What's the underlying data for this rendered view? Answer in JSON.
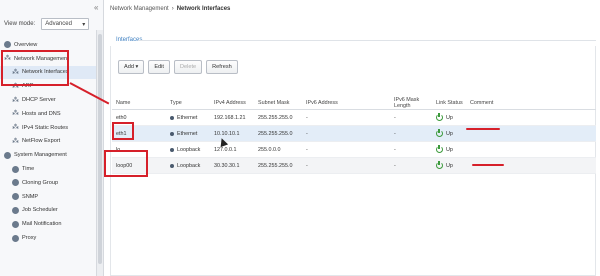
{
  "sidebar": {
    "view_mode_label": "View mode:",
    "view_mode_value": "Advanced",
    "collapse_glyph": "«",
    "items": [
      {
        "label": "Overview",
        "icon": "overview-icon"
      },
      {
        "label": "Network Management",
        "icon": "network-icon"
      },
      {
        "label": "Network Interfaces",
        "icon": "network-interfaces-icon"
      },
      {
        "label": "ARP",
        "icon": "arp-icon"
      },
      {
        "label": "DHCP Server",
        "icon": "dhcp-icon"
      },
      {
        "label": "Hosts and DNS",
        "icon": "hosts-dns-icon"
      },
      {
        "label": "IPv4 Static Routes",
        "icon": "routes-icon"
      },
      {
        "label": "NetFlow Export",
        "icon": "netflow-icon"
      },
      {
        "label": "System Management",
        "icon": "system-icon"
      },
      {
        "label": "Time",
        "icon": "time-icon"
      },
      {
        "label": "Cloning Group",
        "icon": "cloning-icon"
      },
      {
        "label": "SNMP",
        "icon": "snmp-icon"
      },
      {
        "label": "Job Scheduler",
        "icon": "scheduler-icon"
      },
      {
        "label": "Mail Notification",
        "icon": "mail-icon"
      },
      {
        "label": "Proxy",
        "icon": "proxy-icon"
      }
    ]
  },
  "breadcrumb": {
    "parent": "Network Management",
    "separator": "›",
    "current": "Network Interfaces"
  },
  "section": {
    "title": "Interfaces"
  },
  "toolbar": {
    "add_label": "Add ▾",
    "edit_label": "Edit",
    "delete_label": "Delete",
    "refresh_label": "Refresh"
  },
  "table": {
    "headers": {
      "name": "Name",
      "type": "Type",
      "ipv4": "IPv4 Address",
      "mask": "Subnet Mask",
      "ipv6": "IPv6 Address",
      "ipv6len": "IPv6 Mask Length",
      "status": "Link Status",
      "comment": "Comment"
    },
    "rows": [
      {
        "name": "eth0",
        "type": "Ethernet",
        "ipv4": "192.168.1.21",
        "mask": "255.255.255.0",
        "ipv6": "-",
        "ipv6len": "-",
        "status": "Up",
        "comment": ""
      },
      {
        "name": "eth1",
        "type": "Ethernet",
        "ipv4": "10.10.10.1",
        "mask": "255.255.255.0",
        "ipv6": "-",
        "ipv6len": "-",
        "status": "Up",
        "comment": ""
      },
      {
        "name": "lo",
        "type": "Loopback",
        "ipv4": "127.0.0.1",
        "mask": "255.0.0.0",
        "ipv6": "-",
        "ipv6len": "-",
        "status": "Up",
        "comment": ""
      },
      {
        "name": "loop00",
        "type": "Loopback",
        "ipv4": "30.30.30.1",
        "mask": "255.255.255.0",
        "ipv6": "-",
        "ipv6len": "-",
        "status": "Up",
        "comment": ""
      }
    ]
  },
  "colors": {
    "annotation_red": "#d6202a",
    "accent_blue": "#3d7fc1",
    "status_green": "#3c9a3c",
    "selected_row": "#e3edf8"
  }
}
